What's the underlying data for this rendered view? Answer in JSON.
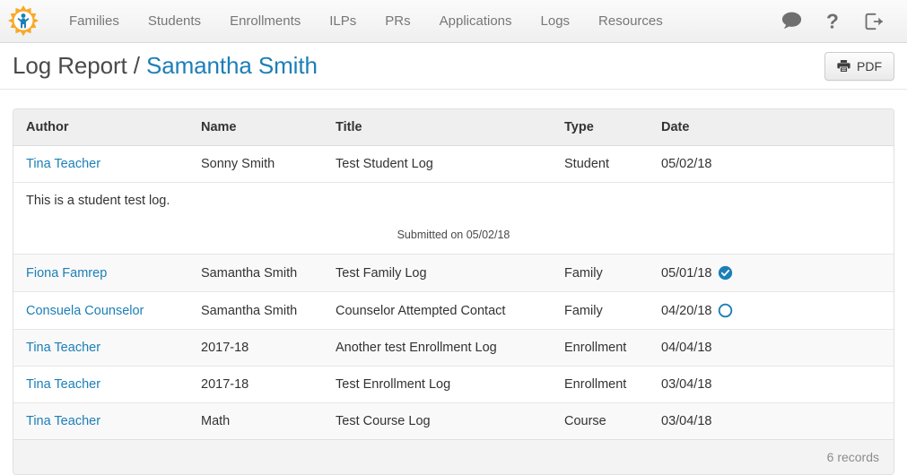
{
  "app": {
    "logo_icon": "sun-person-logo",
    "brand_color": "#f5a623",
    "accent_color": "#1b7fb8"
  },
  "navbar": {
    "items": [
      {
        "label": "Families"
      },
      {
        "label": "Students"
      },
      {
        "label": "Enrollments"
      },
      {
        "label": "ILPs"
      },
      {
        "label": "PRs"
      },
      {
        "label": "Applications"
      },
      {
        "label": "Logs"
      },
      {
        "label": "Resources"
      }
    ],
    "actions": [
      {
        "icon": "chat-bubble-icon",
        "label": "Messages"
      },
      {
        "icon": "question-mark-icon",
        "label": "Help"
      },
      {
        "icon": "logout-icon",
        "label": "Log out"
      }
    ]
  },
  "header": {
    "title_prefix": "Log Report / ",
    "title_subject": "Samantha Smith",
    "pdf_button": {
      "label": "PDF",
      "icon": "printer-icon"
    }
  },
  "table": {
    "columns": [
      "Author",
      "Name",
      "Title",
      "Type",
      "Date"
    ],
    "rows": [
      {
        "author": "Tina Teacher",
        "name": "Sonny Smith",
        "title": "Test Student Log",
        "type": "Student",
        "date": "05/02/18",
        "status_icon": "",
        "detail": {
          "body": "This is a student test log.",
          "submitted": "Submitted on 05/02/18"
        }
      },
      {
        "author": "Fiona Famrep",
        "name": "Samantha Smith",
        "title": "Test Family Log",
        "type": "Family",
        "date": "05/01/18",
        "status_icon": "check-circle-filled-icon"
      },
      {
        "author": "Consuela Counselor",
        "name": "Samantha Smith",
        "title": "Counselor Attempted Contact",
        "type": "Family",
        "date": "04/20/18",
        "status_icon": "circle-outline-icon"
      },
      {
        "author": "Tina Teacher",
        "name": "2017-18",
        "title": "Another test Enrollment Log",
        "type": "Enrollment",
        "date": "04/04/18",
        "status_icon": ""
      },
      {
        "author": "Tina Teacher",
        "name": "2017-18",
        "title": "Test Enrollment Log",
        "type": "Enrollment",
        "date": "03/04/18",
        "status_icon": ""
      },
      {
        "author": "Tina Teacher",
        "name": "Math",
        "title": "Test Course Log",
        "type": "Course",
        "date": "03/04/18",
        "status_icon": ""
      }
    ],
    "footer": {
      "record_count_label": "6 records"
    }
  }
}
